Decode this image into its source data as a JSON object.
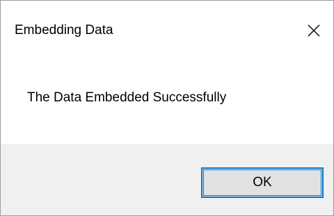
{
  "dialog": {
    "title": "Embedding Data",
    "close_icon": "close-icon",
    "message": "The Data Embedded Successfully",
    "ok_label": "OK"
  },
  "colors": {
    "content_background": "#ffffff",
    "footer_background": "#f0f0f0",
    "button_background": "#e1e1e1",
    "button_focus_border": "#0078d7",
    "window_border": "#9c9c9c"
  }
}
